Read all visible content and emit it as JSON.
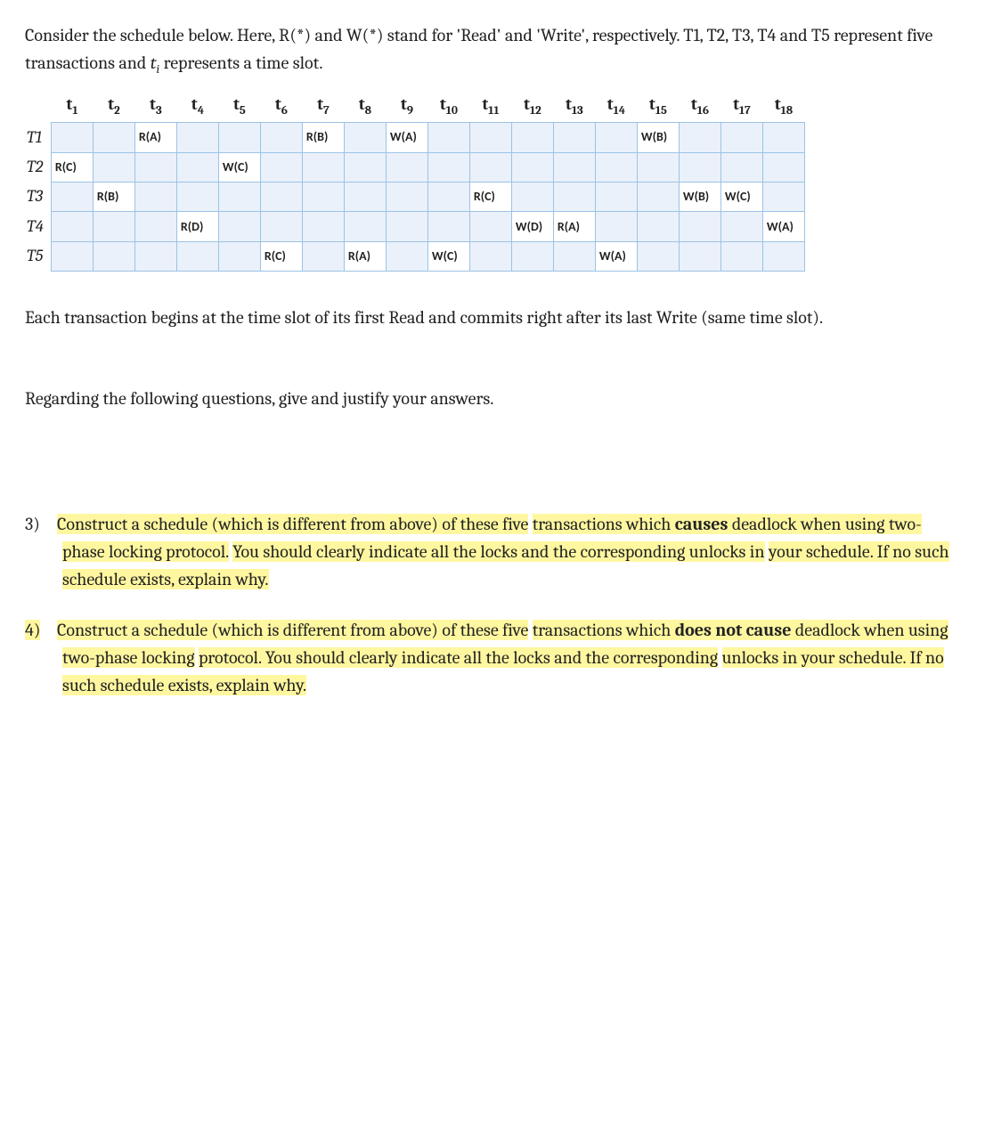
{
  "intro_html": "Consider the schedule below. Here, R(*) and W(*) stand for 'Read' and 'Write', respectively. T1, T2, T3, T4 and T5 represent five transactions and <i>t<span class=\"sub\">i</span></i> represents a time slot.",
  "schedule": {
    "time_labels": [
      "t1",
      "t2",
      "t3",
      "t4",
      "t5",
      "t6",
      "t7",
      "t8",
      "t9",
      "t10",
      "t11",
      "t12",
      "t13",
      "t14",
      "t15",
      "t16",
      "t17",
      "t18"
    ],
    "rows": [
      {
        "name": "T1",
        "cells": [
          "",
          "",
          "R(A)",
          "",
          "",
          "",
          "R(B)",
          "",
          "W(A)",
          "",
          "",
          "",
          "",
          "",
          "W(B)",
          "",
          "",
          ""
        ]
      },
      {
        "name": "T2",
        "cells": [
          "R(C)",
          "",
          "",
          "",
          "W(C)",
          "",
          "",
          "",
          "",
          "",
          "",
          "",
          "",
          "",
          "",
          "",
          "",
          ""
        ]
      },
      {
        "name": "T3",
        "cells": [
          "",
          "R(B)",
          "",
          "",
          "",
          "",
          "",
          "",
          "",
          "",
          "R(C)",
          "",
          "",
          "",
          "",
          "W(B)",
          "W(C)",
          ""
        ]
      },
      {
        "name": "T4",
        "cells": [
          "",
          "",
          "",
          "R(D)",
          "",
          "",
          "",
          "",
          "",
          "",
          "",
          "W(D)",
          "R(A)",
          "",
          "",
          "",
          "",
          "W(A)"
        ]
      },
      {
        "name": "T5",
        "cells": [
          "",
          "",
          "",
          "",
          "",
          "R(C)",
          "",
          "R(A)",
          "",
          "W(C)",
          "",
          "",
          "",
          "W(A)",
          "",
          "",
          "",
          ""
        ]
      }
    ]
  },
  "para1": "Each transaction begins at the time slot of its first Read and commits right after its last Write (same time slot).",
  "para2": "Regarding the following questions, give and justify your answers.",
  "questions": [
    {
      "num": "3)",
      "segments": [
        {
          "text": "Construct a schedule (which is different from above) of these five",
          "hl": true
        },
        {
          "text": " ",
          "hl": false
        },
        {
          "text": "transactions which ",
          "hl": true
        },
        {
          "text": "causes",
          "hl": true,
          "bold": true
        },
        {
          "text": " deadlock when using two-phase locking protocol.",
          "hl": true
        },
        {
          "text": " ",
          "hl": false
        },
        {
          "text": "You should clearly indicate all the locks and the corresponding unlocks in",
          "hl": true
        },
        {
          "text": " ",
          "hl": false
        },
        {
          "text": "your schedule. If no such schedule exists, explain why.",
          "hl": true
        }
      ]
    },
    {
      "num": "4)",
      "segments": [
        {
          "text": "Construct a schedule (which is different from above) of these five",
          "hl": true
        },
        {
          "text": " ",
          "hl": false
        },
        {
          "text": "transactions which ",
          "hl": true
        },
        {
          "text": "does not cause",
          "hl": true,
          "bold": true
        },
        {
          "text": " deadlock when using two-phase locking",
          "hl": true
        },
        {
          "text": " ",
          "hl": false
        },
        {
          "text": "protocol. You should clearly indicate all the locks and the corresponding",
          "hl": true
        },
        {
          "text": " ",
          "hl": false
        },
        {
          "text": "unlocks in your schedule. If no such schedule exists, explain why.",
          "hl": true
        }
      ]
    }
  ]
}
